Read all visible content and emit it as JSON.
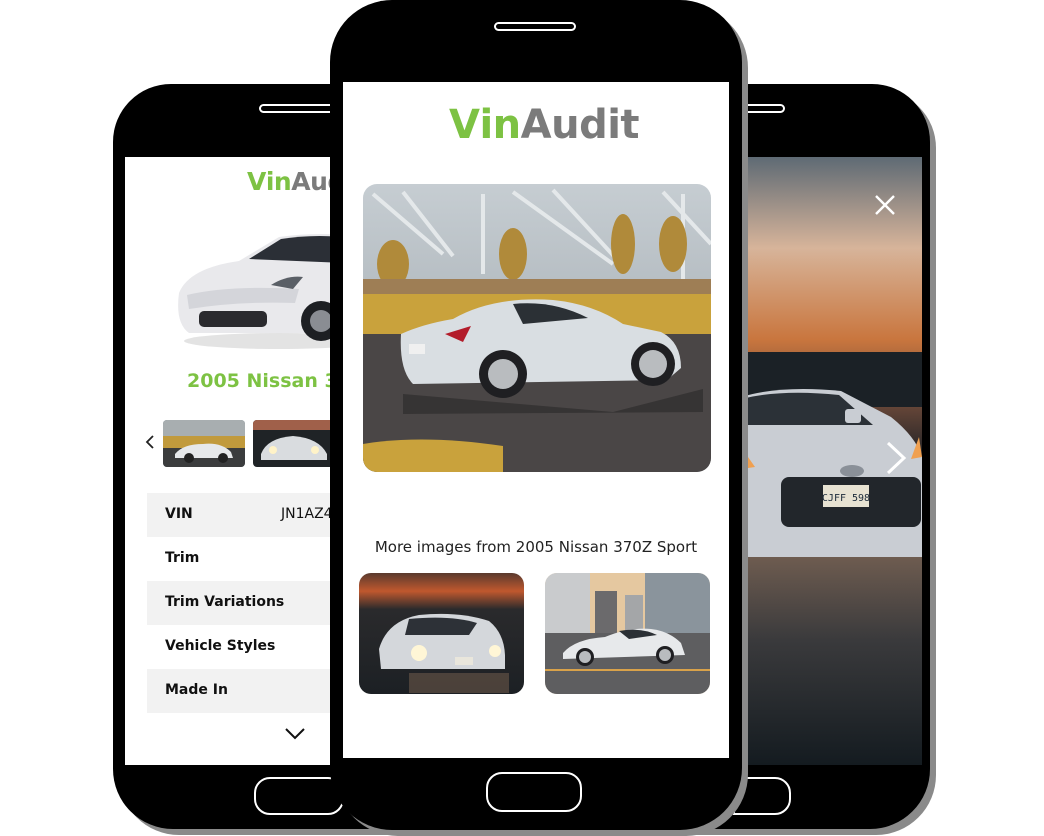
{
  "brand": {
    "logo_v": "V",
    "logo_in": "in",
    "logo_audit": "Audit",
    "green": "#7dc243",
    "gray": "#7b7b7b"
  },
  "left_phone": {
    "vehicle_title": "2005 Nissan 370Z Sport",
    "prev_icon": "chevron-left-icon",
    "thumbnails": [
      {
        "alt": "Nissan 370Z side view in field"
      },
      {
        "alt": "Nissan 370Z front at sunset"
      }
    ],
    "spec_rows": [
      {
        "label": "VIN",
        "value": "JN1AZ4"
      },
      {
        "label": "Trim",
        "value": ""
      },
      {
        "label": "Trim Variations",
        "value": ""
      },
      {
        "label": "Vehicle Styles",
        "value": ""
      },
      {
        "label": "Made In",
        "value": ""
      }
    ],
    "expand_icon": "chevron-down-icon"
  },
  "center_phone": {
    "hero_alt": "White Nissan 370Z parked near bridge at golden hour",
    "caption": "More images from 2005 Nissan 370Z Sport",
    "gallery": [
      {
        "alt": "Nissan 370Z front with headlights at sunset"
      },
      {
        "alt": "Nissan 370Z side profile in city parking lot"
      }
    ]
  },
  "right_phone": {
    "close_icon": "close-icon",
    "next_icon": "chevron-right-icon",
    "image_alt": "Nissan 370Z front close-up at sunset",
    "plate_text": "CJFF 598"
  }
}
